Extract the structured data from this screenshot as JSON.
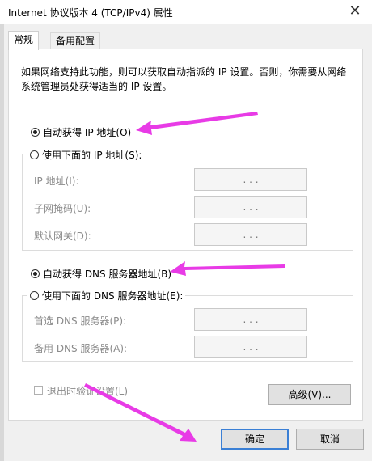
{
  "window": {
    "title": "Internet 协议版本 4 (TCP/IPv4) 属性",
    "close_glyph": "✕"
  },
  "tabs": [
    {
      "label": "常规"
    },
    {
      "label": "备用配置"
    }
  ],
  "description": "如果网络支持此功能，则可以获取自动指派的 IP 设置。否则，你需要从网络系统管理员处获得适当的 IP 设置。",
  "ip": {
    "auto_label": "自动获得 IP 地址(O)",
    "manual_label": "使用下面的 IP 地址(S):",
    "fields": [
      {
        "label": "IP 地址(I):",
        "value": ".  .  ."
      },
      {
        "label": "子网掩码(U):",
        "value": ".  .  ."
      },
      {
        "label": "默认网关(D):",
        "value": ".  .  ."
      }
    ]
  },
  "dns": {
    "auto_label": "自动获得 DNS 服务器地址(B)",
    "manual_label": "使用下面的 DNS 服务器地址(E):",
    "fields": [
      {
        "label": "首选 DNS 服务器(P):",
        "value": ".  .  ."
      },
      {
        "label": "备用 DNS 服务器(A):",
        "value": ".  .  ."
      }
    ]
  },
  "validate_label": "退出时验证设置(L)",
  "buttons": {
    "advanced": "高级(V)...",
    "ok": "确定",
    "cancel": "取消"
  },
  "colors": {
    "annotation_arrow": "#e83be6",
    "default_button_border": "#3a7fd5"
  }
}
